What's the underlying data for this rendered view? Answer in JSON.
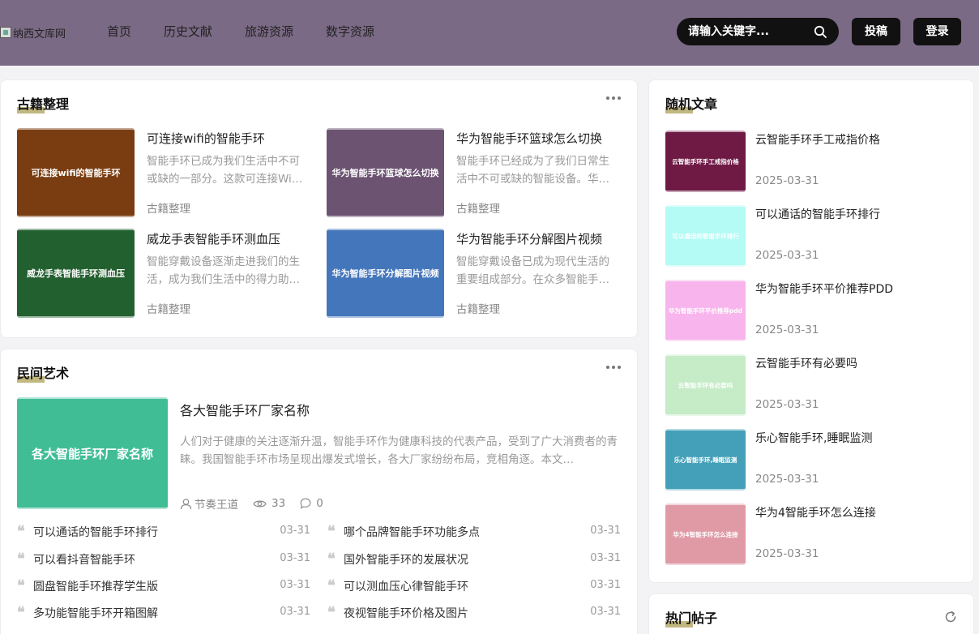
{
  "header": {
    "logo_alt": "纳西文库网",
    "nav": [
      "首页",
      "历史文献",
      "旅游资源",
      "数字资源"
    ],
    "search_placeholder": "请输入关键字...",
    "post_label": "投稿",
    "login_label": "登录"
  },
  "guji": {
    "title": "古籍整理",
    "cards": [
      {
        "thumb": "可连接wifi的智能手环",
        "title": "可连接wifi的智能手环",
        "desc": "智能手环已成为我们生活中不可或缺的一部分。这款可连接Wi…",
        "category": "古籍整理",
        "color": "#7a3d11"
      },
      {
        "thumb": "华为智能手环篮球怎么切换",
        "title": "华为智能手环篮球怎么切换",
        "desc": "智能手环已经成为了我们日常生活中不可或缺的智能设备。华…",
        "category": "古籍整理",
        "color": "#6c5372"
      },
      {
        "thumb": "威龙手表智能手环测血压",
        "title": "威龙手表智能手环测血压",
        "desc": "智能穿戴设备逐渐走进我们的生活，成为我们生活中的得力助…",
        "category": "古籍整理",
        "color": "#236030"
      },
      {
        "thumb": "华为智能手环分解图片视频",
        "title": "华为智能手环分解图片视频",
        "desc": "智能穿戴设备已成为现代生活的重要组成部分。在众多智能手…",
        "category": "古籍整理",
        "color": "#4476bb"
      }
    ]
  },
  "minjian": {
    "title": "民间艺术",
    "feature": {
      "thumb": "各大智能手环厂家名称",
      "title": "各大智能手环厂家名称",
      "desc": "人们对于健康的关注逐渐升温，智能手环作为健康科技的代表产品，受到了广大消费者的青睐。我国智能手环市场呈现出爆发式增长，各大厂家纷纷布局，竞相角逐。本文…",
      "author": "节奏王道",
      "views": "33",
      "comments": "0"
    },
    "list": [
      {
        "title": "可以通话的智能手环排行",
        "date": "03-31"
      },
      {
        "title": "哪个品牌智能手环功能多点",
        "date": "03-31"
      },
      {
        "title": "可以看抖音智能手环",
        "date": "03-31"
      },
      {
        "title": "国外智能手环的发展状况",
        "date": "03-31"
      },
      {
        "title": "圆盘智能手环推荐学生版",
        "date": "03-31"
      },
      {
        "title": "可以测血压心律智能手环",
        "date": "03-31"
      },
      {
        "title": "多功能智能手环开箱图解",
        "date": "03-31"
      },
      {
        "title": "夜视智能手环价格及图片",
        "date": "03-31"
      }
    ]
  },
  "random": {
    "title": "随机文章",
    "items": [
      {
        "thumb": "云智能手环手工戒指价格",
        "title": "云智能手环手工戒指价格",
        "date": "2025-03-31",
        "color": "#6e1a45"
      },
      {
        "thumb": "可以通话的智能手环排行",
        "title": "可以通话的智能手环排行",
        "date": "2025-03-31",
        "color": "#b3fbf4"
      },
      {
        "thumb": "华为智能手环平价推荐pdd",
        "title": "华为智能手环平价推荐PDD",
        "date": "2025-03-31",
        "color": "#f8b4ec"
      },
      {
        "thumb": "云智能手环有必要吗",
        "title": "云智能手环有必要吗",
        "date": "2025-03-31",
        "color": "#c5ebc7"
      },
      {
        "thumb": "乐心智能手环,睡眠监测",
        "title": "乐心智能手环,睡眠监测",
        "date": "2025-03-31",
        "color": "#44a0b8"
      },
      {
        "thumb": "华为4智能手环怎么连接",
        "title": "华为4智能手环怎么连接",
        "date": "2025-03-31",
        "color": "#e09aa6"
      }
    ]
  },
  "hot": {
    "title": "热门帖子"
  }
}
